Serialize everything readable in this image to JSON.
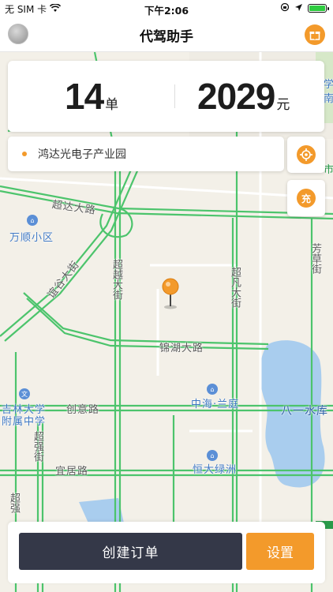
{
  "status_bar": {
    "carrier": "无 SIM 卡",
    "time": "下午2:06",
    "battery_level": 1.0
  },
  "nav": {
    "title": "代驾助手"
  },
  "stats": {
    "orders_value": "14",
    "orders_unit": "单",
    "income_value": "2029",
    "income_unit": "元"
  },
  "location": {
    "address": "鸿达光电子产业园"
  },
  "fabs": {
    "recharge_label": "充"
  },
  "map_labels": {
    "chaoda_road": "超达大路",
    "wanshun": "万顺小区",
    "yigu_street": "谊谷大街",
    "chaoyue_street": "超越大街",
    "chaofan_street": "超凡大街",
    "jinhu_road": "锦湖大路",
    "jilin_school": "吉林大学附属中学",
    "chuangyi_road": "创意路",
    "zhonghai": "中海·兰庭",
    "bayi_reservoir": "八一水库",
    "chaoqiang_street": "超强街",
    "yiju_road": "宜居路",
    "hengda": "恒大绿洲",
    "fangcao_street": "芳草街",
    "chao_bottom": "超强",
    "edge_school": "学",
    "edge_south": "南",
    "edge_market": "市"
  },
  "buttons": {
    "create_order": "创建订单",
    "settings": "设置"
  },
  "colors": {
    "accent": "#f39a2b",
    "primary_dark": "#343848",
    "road_green": "#4cc46c",
    "water": "#a9cdee"
  }
}
